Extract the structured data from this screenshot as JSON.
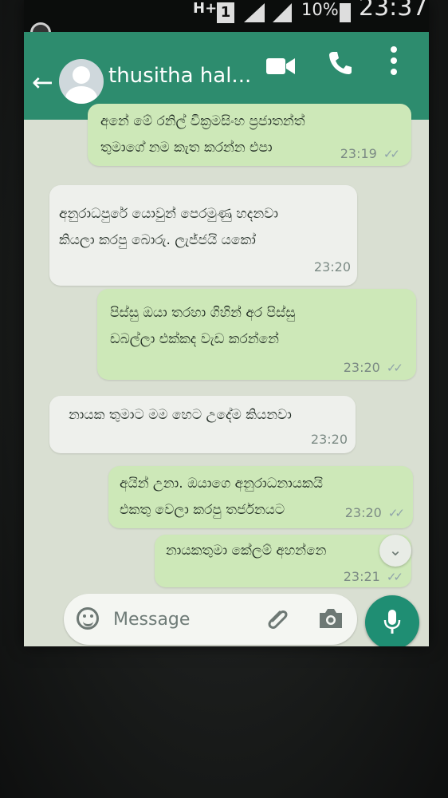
{
  "status_bar": {
    "network_label": "H+",
    "sim_label": "1",
    "battery_percent": "10%",
    "time": "23:37"
  },
  "toolbar": {
    "title": "thusitha hal...",
    "back_icon": "arrow-left-icon",
    "video_icon": "video-call-icon",
    "call_icon": "phone-icon",
    "menu_icon": "more-vert-icon",
    "color": "#2d8c6e"
  },
  "messages": [
    {
      "direction": "out",
      "text": "අනේ මේ රනිල් වික්‍රමසිංහ ප්‍රජාතන්ත්‍\nතුමාගේ නම කැත කරන්න එපා",
      "time": "23:19",
      "ticks": "✓✓"
    },
    {
      "direction": "in",
      "text": "අනුරාධපුරේ යොවුන් පෙරමුණු හදනවා\nකියලා කරපු බොරු. ලැජ්ජයි යකෝ",
      "time": "23:20"
    },
    {
      "direction": "out",
      "text": "පිස්සු ඔයා තරහා ගිහින් අර පිස්සු\nඩබල්ලා එක්කද වැඩ කරන්නේ",
      "time": "23:20",
      "ticks": "✓✓"
    },
    {
      "direction": "in",
      "text": "නායක තුමාට මම හෙට උදේම කියනවා",
      "time": "23:20"
    },
    {
      "direction": "out",
      "text": "අයින් උනා. ඔයාගෙ අනුරාධනායකයි\nඑකතු වෙලා කරපු තර්ජනයට",
      "time": "23:20",
      "ticks": "✓✓"
    },
    {
      "direction": "out",
      "text": "නායකතුමා කේලම් අහන්නෙ",
      "time": "23:21",
      "ticks": "✓✓"
    }
  ],
  "input": {
    "placeholder": "Message",
    "emoji_icon": "emoji-icon",
    "attach_icon": "paperclip-icon",
    "camera_icon": "camera-icon",
    "mic_icon": "microphone-icon",
    "accent": "#1f8e73"
  },
  "chat": {
    "background": "#d9dfd2",
    "outgoing_color": "#cde8b8",
    "incoming_color": "#eef0ec"
  }
}
